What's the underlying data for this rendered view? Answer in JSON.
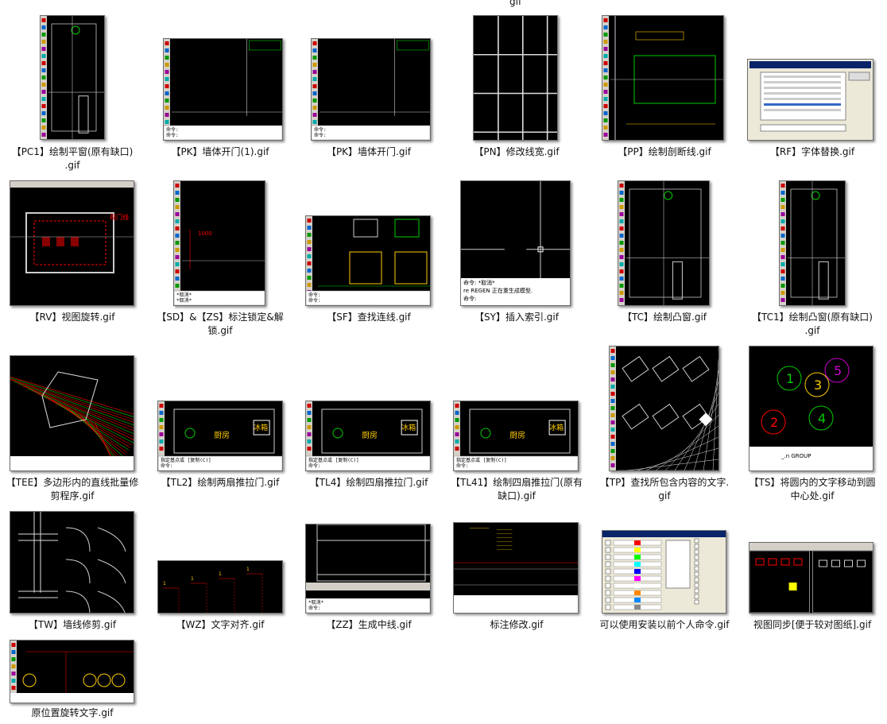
{
  "partial_label": "gif",
  "files": [
    {
      "label": "【PC1】绘制平窗(原有缺口)\n.gif",
      "kind": "cad-window"
    },
    {
      "label": "【PK】墙体开门(1).gif",
      "kind": "cad-cmd"
    },
    {
      "label": "【PK】墙体开门.gif",
      "kind": "cad-cmd"
    },
    {
      "label": "【PN】修改线宽.gif",
      "kind": "grid"
    },
    {
      "label": "【PP】绘制剖断线.gif",
      "kind": "cad-section"
    },
    {
      "label": "【RF】字体替换.gif",
      "kind": "dialog"
    },
    {
      "label": "【RV】视图旋转.gif",
      "kind": "cad-rotate"
    },
    {
      "label": "【SD】&【ZS】标注锁定&解\n锁.gif",
      "kind": "cad-dim"
    },
    {
      "label": "【SF】查找连线.gif",
      "kind": "cad-elev"
    },
    {
      "label": "【SY】插入索引.gif",
      "kind": "cad-cross"
    },
    {
      "label": "【TC】绘制凸窗.gif",
      "kind": "cad-window"
    },
    {
      "label": "【TC1】绘制凸窗(原有缺口)\n.gif",
      "kind": "cad-window"
    },
    {
      "label": "【TEE】多边形内的直线批量修\n剪程序.gif",
      "kind": "cad-hatch"
    },
    {
      "label": "【TL2】绘制两扇推拉门.gif",
      "kind": "cad-kitchen"
    },
    {
      "label": "【TL4】绘制四扇推拉门.gif",
      "kind": "cad-kitchen"
    },
    {
      "label": "【TL41】绘制四扇推拉门(原有\n缺口).gif",
      "kind": "cad-kitchen"
    },
    {
      "label": "【TP】查找所包含内容的文字.\ngif",
      "kind": "cad-plan"
    },
    {
      "label": "【TS】将圆内的文字移动到圆\n中心处.gif",
      "kind": "cad-circles"
    },
    {
      "label": "【TW】墙线修剪.gif",
      "kind": "cad-walls"
    },
    {
      "label": "【WZ】文字对齐.gif",
      "kind": "cad-text"
    },
    {
      "label": "【ZZ】生成中线.gif",
      "kind": "cad-midline"
    },
    {
      "label": "标注修改.gif",
      "kind": "cad-dimedit"
    },
    {
      "label": "可以使用安装以前个人命令.gif",
      "kind": "dialog2"
    },
    {
      "label": "视图同步[便于较对图纸].gif",
      "kind": "cad-sync"
    },
    {
      "label": "原位置旋转文字.gif",
      "kind": "cad-rottext"
    }
  ],
  "thumb_text": {
    "cmd_prompt": "命令:",
    "cancel": "*取消*",
    "regen": "re REGEN 正在重生成模型.",
    "cmd_cancel": "命令: *取消*",
    "group": "_.n GROUP",
    "kitchen": "厨房",
    "fridge": "冰箱",
    "tl2_prompt": "指定基点或 [复制(C)]",
    "rv_note": "视门线",
    "circle_nums": [
      "1",
      "3",
      "5",
      "2",
      "4"
    ]
  }
}
